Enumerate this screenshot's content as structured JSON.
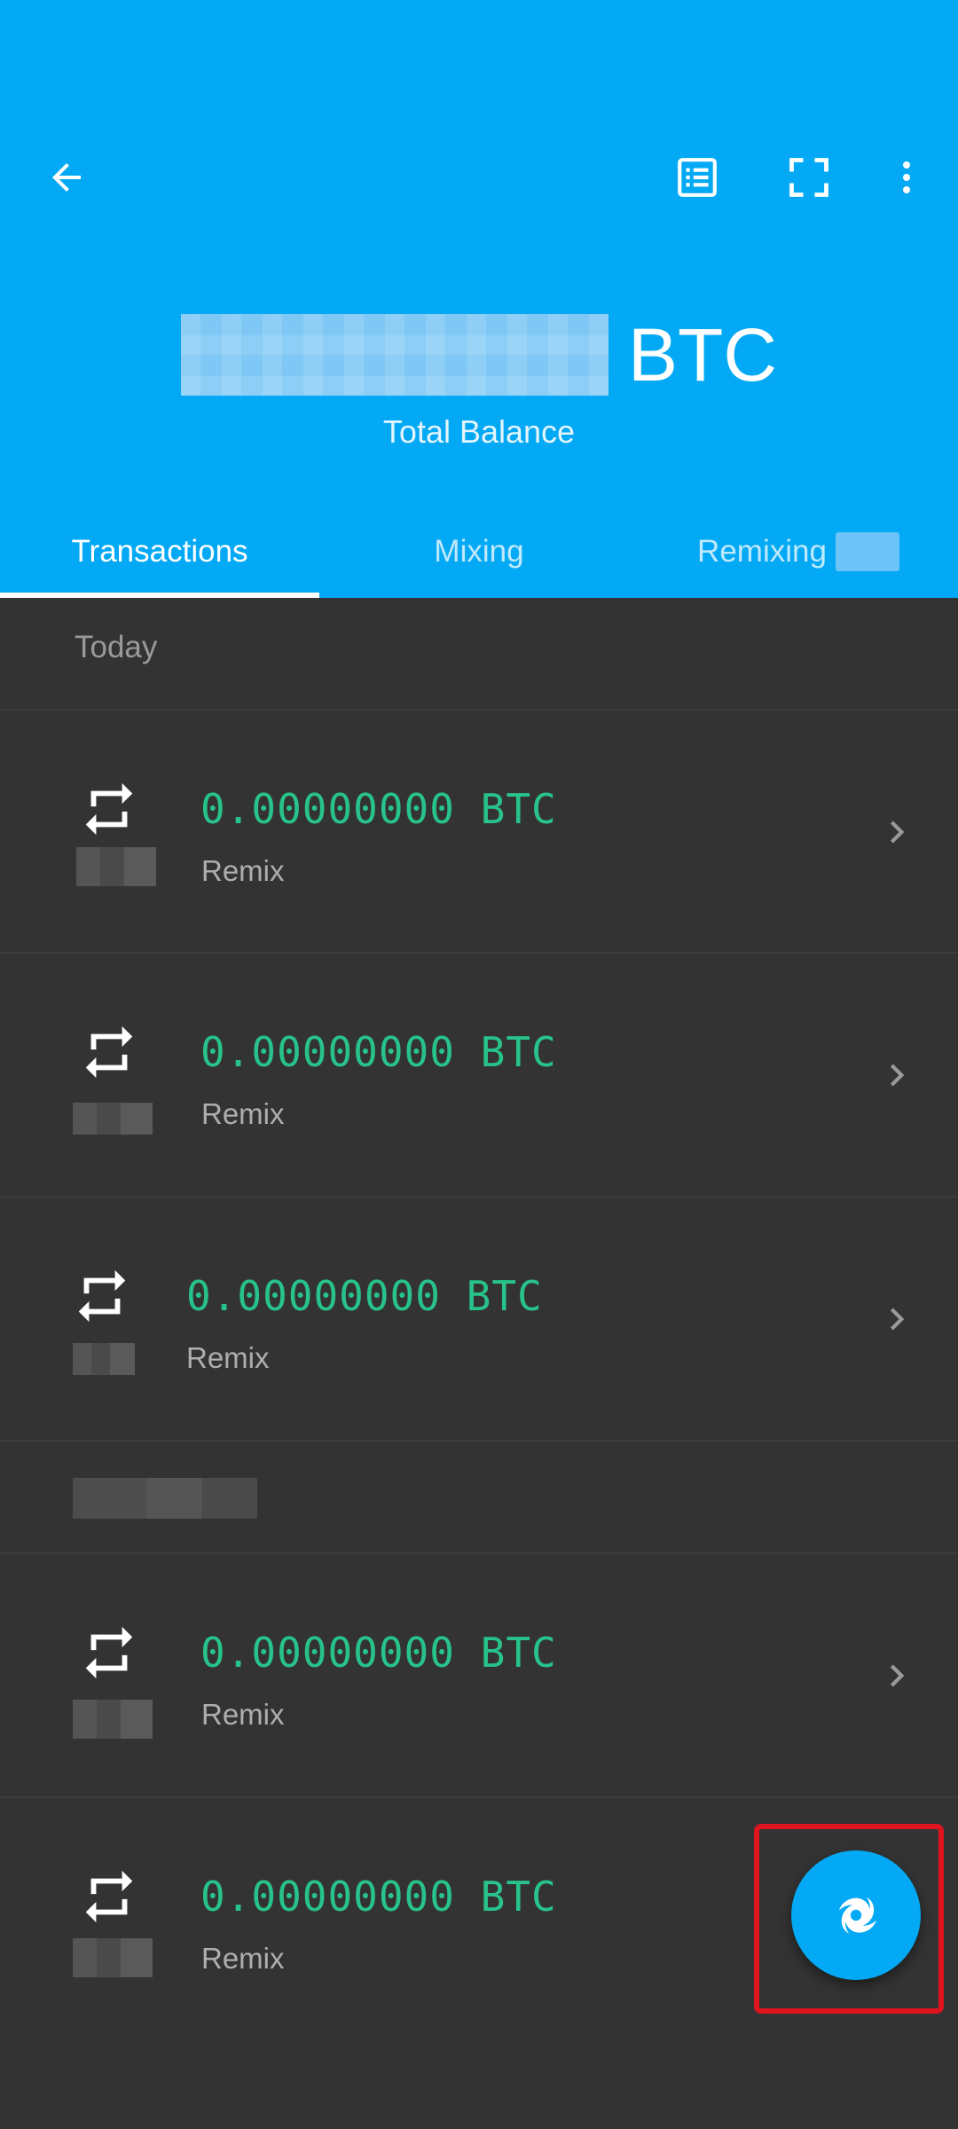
{
  "header": {
    "balance_unit": "BTC",
    "balance_label": "Total Balance",
    "accent_color": "#03A9F4"
  },
  "tabs": [
    {
      "label": "Transactions",
      "active": true
    },
    {
      "label": "Mixing",
      "active": false
    },
    {
      "label": "Remixing",
      "active": false
    }
  ],
  "sections": [
    {
      "label": "Today"
    }
  ],
  "transactions": [
    {
      "amount": "0.00000000 BTC",
      "type": "Remix",
      "icon": "repeat-icon"
    },
    {
      "amount": "0.00000000 BTC",
      "type": "Remix",
      "icon": "repeat-icon"
    },
    {
      "amount": "0.00000000 BTC",
      "type": "Remix",
      "icon": "repeat-icon"
    },
    {
      "amount": "0.00000000 BTC",
      "type": "Remix",
      "icon": "repeat-icon"
    },
    {
      "amount": "0.00000000 BTC",
      "type": "Remix",
      "icon": "repeat-icon"
    }
  ],
  "icons": {
    "back": "arrow-back-icon",
    "list": "list-icon",
    "scan": "scan-icon",
    "more": "more-vert-icon",
    "chevron": "chevron-right-icon",
    "fab": "whirlpool-icon"
  },
  "colors": {
    "amount": "#27C38A",
    "background": "#333333",
    "highlight": "#E0141E"
  }
}
